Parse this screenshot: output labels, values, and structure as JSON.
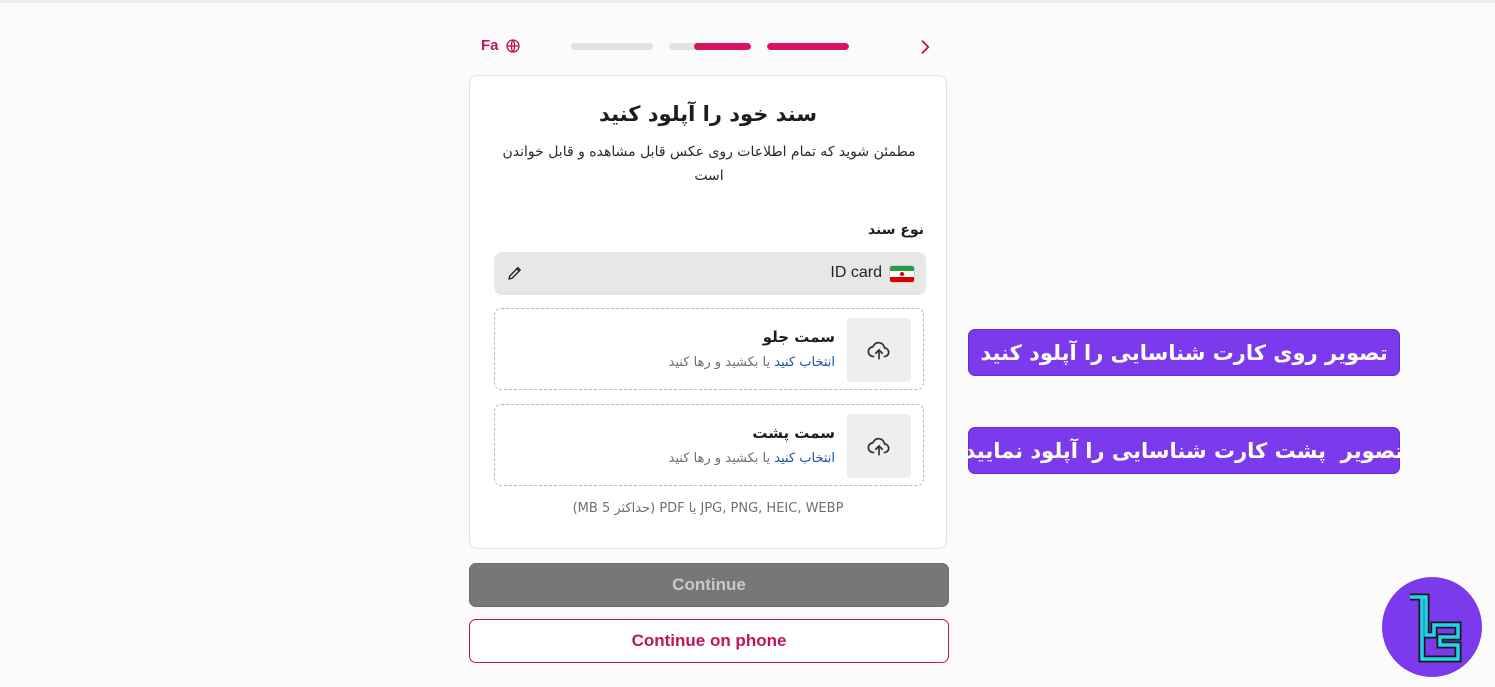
{
  "header": {
    "language_label": "Fa",
    "steps": [
      {
        "state": "inactive",
        "progress": 0
      },
      {
        "state": "partial",
        "progress": 0.7
      },
      {
        "state": "complete",
        "progress": 1
      }
    ],
    "accent_color": "#d6145f"
  },
  "card": {
    "title": "سند خود را آپلود کنید",
    "subtitle": "مطمئن شوید که تمام اطلاعات روی عکس قابل مشاهده و قابل خواندن است",
    "doc_type_label": "نوع سند",
    "doc_type_value": "ID card",
    "doc_type_flag": "iran-flag",
    "front": {
      "title": "سمت جلو",
      "hint_link": "انتخاب کنید",
      "hint_rest": "یا بکشید و رها کنید"
    },
    "back": {
      "title": "سمت پشت",
      "hint_link": "انتخاب کنید",
      "hint_rest": "یا بکشید و رها کنید"
    },
    "formats": "JPG, PNG, HEIC, WEBP یا PDF (حداکثر 5 MB)"
  },
  "buttons": {
    "continue": "Continue",
    "continue_on_phone": "Continue on phone"
  },
  "annotations": {
    "front_callout": "تصویر روی کارت شناسایی را آپلود کنید",
    "back_callout": "تصویر  پشت کارت شناسایی را آپلود نمایید",
    "callout_color": "#7c3aed"
  },
  "icons": [
    "globe-icon",
    "chevron-right-icon",
    "pencil-icon",
    "upload-cloud-icon",
    "brand-logo"
  ]
}
